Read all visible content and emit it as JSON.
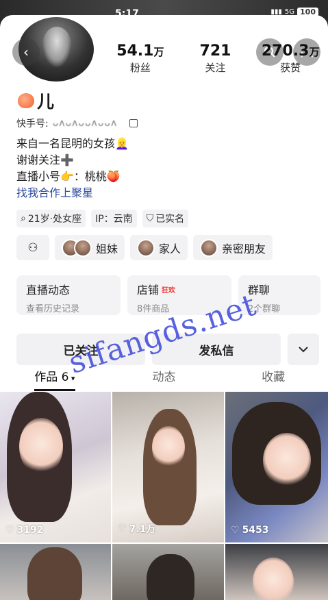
{
  "status_bar": {
    "time": "5:17",
    "network": "5G",
    "battery": "100"
  },
  "profile": {
    "nickname": "儿",
    "account_label": "快手号:",
    "account_id": "ᴗᴧᴗᴧᴗᴗᴧᴗᴗᴧ",
    "bio_lines": [
      "来自一名昆明的女孩👱‍♀️",
      "谢谢关注➕",
      "直播小号👉：桃桃🍑"
    ],
    "bio_link": "找我合作上聚星"
  },
  "stats": [
    {
      "num": "54.1",
      "unit": "万",
      "label": "粉丝"
    },
    {
      "num": "721",
      "unit": "",
      "label": "关注"
    },
    {
      "num": "270.3",
      "unit": "万",
      "label": "获赞"
    }
  ],
  "chips": [
    "21岁·处女座",
    "IP：云南",
    "已实名"
  ],
  "relations": [
    "姐妹",
    "家人",
    "亲密朋友"
  ],
  "cards": [
    {
      "title": "直播动态",
      "badge": "",
      "sub": "查看历史记录"
    },
    {
      "title": "店铺",
      "badge": "狂欢",
      "sub": "8件商品"
    },
    {
      "title": "群聊",
      "badge": "",
      "sub": "2个群聊"
    }
  ],
  "actions": {
    "followed": "已关注",
    "message": "发私信"
  },
  "tabs": {
    "works": "作品 6",
    "moments": "动态",
    "favorites": "收藏"
  },
  "posts": [
    {
      "likes": "3192"
    },
    {
      "likes": "7.1万"
    },
    {
      "likes": "5453"
    }
  ],
  "watermark": "sifangds.net",
  "colors": {
    "link": "#2b4a9c",
    "badge": "#e53935",
    "watermark": "#4650dc"
  }
}
